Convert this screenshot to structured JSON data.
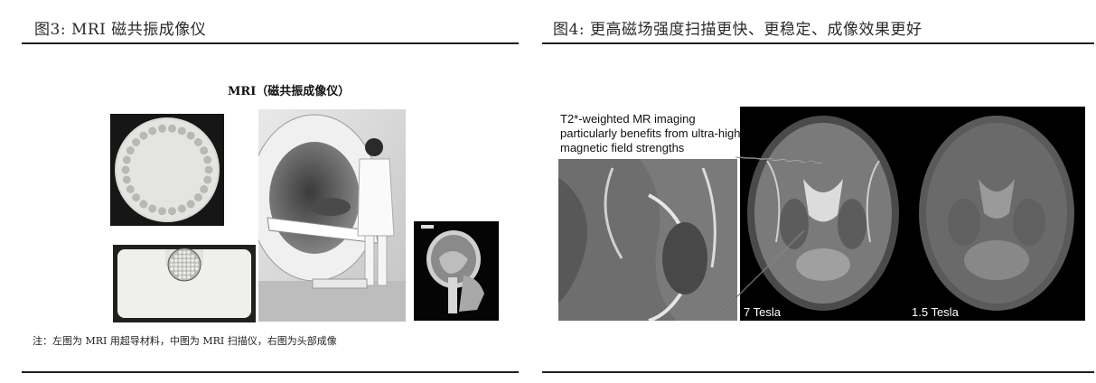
{
  "left_figure": {
    "title": "图3:  MRI 磁共振成像仪",
    "heading": "MRI（磁共振成像仪）",
    "note": "注：左图为 MRI 用超导材料，中图为 MRI 扫描仪，右图为头部成像",
    "images": [
      {
        "name": "superconducting-disc",
        "alt": "MRI 用超导材料（圆盘）"
      },
      {
        "name": "superconducting-cable-cross-section",
        "alt": "MRI 用超导材料（截面）"
      },
      {
        "name": "mri-scanner-photo",
        "alt": "MRI 扫描仪"
      },
      {
        "name": "head-scan-image",
        "alt": "头部成像"
      }
    ]
  },
  "right_figure": {
    "title": "图4:  更高磁场强度扫描更快、更稳定、成像效果更好",
    "caption": "T2*-weighted MR imaging particularly benefits from ultra-high magnetic field strengths",
    "labels": {
      "seven_tesla": "7 Tesla",
      "one_five_tesla": "1.5 Tesla"
    }
  }
}
